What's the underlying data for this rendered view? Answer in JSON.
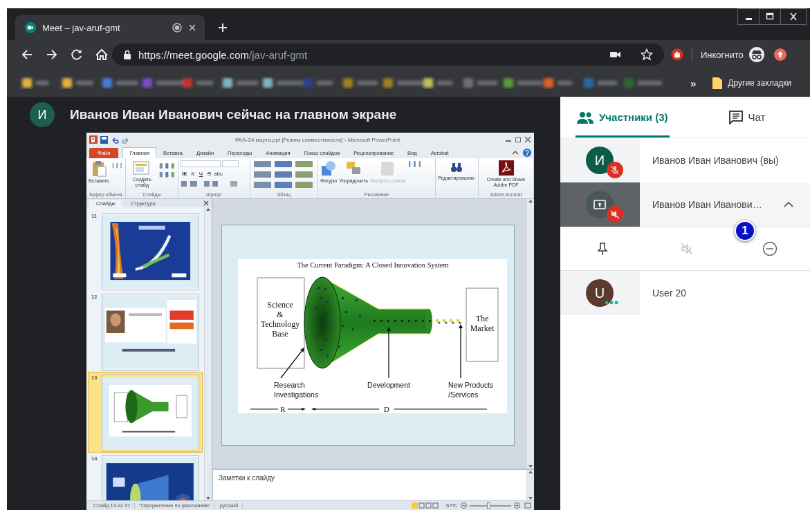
{
  "browser": {
    "tab": {
      "title": "Meet – jav-aruf-gmt"
    },
    "url": {
      "host": "https://meet.google.com",
      "path": "/jav-aruf-gmt"
    },
    "incognito_label": "Инкогнито",
    "bookmarks": {
      "overflow": "»",
      "other": "Другие закладки"
    }
  },
  "stage": {
    "presenter": {
      "initial": "И",
      "text": "Иванов Иван Иванович сейчас на главном экране"
    }
  },
  "powerpoint": {
    "title": "ФКА-24 марта.ppt [Режим совместимости] - Microsoft PowerPoint",
    "ribbon_tabs": [
      {
        "label": "Файл",
        "kind": "file",
        "selected": false
      },
      {
        "label": "Главная",
        "kind": "tab",
        "selected": true
      },
      {
        "label": "Вставка",
        "kind": "tab",
        "selected": false
      },
      {
        "label": "Дизайн",
        "kind": "tab",
        "selected": false
      },
      {
        "label": "Переходы",
        "kind": "tab",
        "selected": false
      },
      {
        "label": "Анимация",
        "kind": "tab",
        "selected": false
      },
      {
        "label": "Показ слайдов",
        "kind": "tab",
        "selected": false
      },
      {
        "label": "Рецензирование",
        "kind": "tab",
        "selected": false
      },
      {
        "label": "Вид",
        "kind": "tab",
        "selected": false
      },
      {
        "label": "Acrobat",
        "kind": "tab",
        "selected": false
      }
    ],
    "ribbon_groups": [
      {
        "label": "Буфер обмена",
        "kind": "clipboard",
        "buttons": [
          "Вставить"
        ]
      },
      {
        "label": "Слайды",
        "kind": "slides",
        "buttons": [
          "Создать слайд"
        ]
      },
      {
        "label": "Шрифт",
        "kind": "font",
        "buttons": [
          "Ж",
          "К",
          "Ч",
          "S",
          "abc"
        ]
      },
      {
        "label": "Абзац",
        "kind": "paragraph"
      },
      {
        "label": "Рисование",
        "kind": "drawing",
        "buttons": [
          "Фигуры",
          "Упорядочить",
          "Экспресс-стили"
        ]
      },
      {
        "kind": "editing",
        "buttons": [
          "Редактирование"
        ]
      },
      {
        "label": "Adobe Acrobat",
        "kind": "acrobat",
        "buttons": [
          "Create and Share Adobe PDF"
        ]
      }
    ],
    "pane_tabs": [
      {
        "label": "Слайды",
        "selected": true
      },
      {
        "label": "Структура",
        "selected": false
      }
    ],
    "thumbnails": [
      {
        "number": "11",
        "selected": false
      },
      {
        "number": "12",
        "selected": false
      },
      {
        "number": "13",
        "selected": true
      },
      {
        "number": "14",
        "selected": false
      }
    ],
    "slide": {
      "title": "The Current Paradigm: A Closed Innovation System",
      "source_lines": [
        "Science",
        "&",
        "Technology",
        "Base"
      ],
      "market_lines": [
        "The",
        "Market"
      ],
      "labels": [
        {
          "lines": [
            "Research",
            "Investigations"
          ]
        },
        {
          "lines": [
            "Development"
          ]
        },
        {
          "lines": [
            "New Products",
            "/Services"
          ]
        }
      ],
      "axis": [
        "R",
        "D"
      ]
    },
    "notes_placeholder": "Заметки к слайду",
    "status_bar": [
      "Слайд 13 из 37",
      "\"Оформление по умолчанию\"",
      "русский"
    ],
    "zoom": "67%",
    "zoom_slider": {
      "level": 0.45
    }
  },
  "participants_panel": {
    "tabs": [
      {
        "label": "Участники (3)",
        "kind": "people",
        "selected": true
      },
      {
        "label": "Чат",
        "kind": "chat",
        "selected": false
      }
    ],
    "participants": [
      {
        "kind": "person",
        "initial": "И",
        "color": "#0d5c48",
        "name": "Иванов Иван Иванович (вы)",
        "mic_muted": true,
        "audio_muted": false,
        "speaking": false,
        "expanded": false
      },
      {
        "kind": "presentation",
        "color": "#4a5757",
        "name": "Иванов Иван Иванови…",
        "mic_muted": false,
        "audio_muted": true,
        "speaking": false,
        "expanded": true
      },
      {
        "kind": "person",
        "initial": "U",
        "color": "#5d3a2e",
        "name": "User 20",
        "mic_muted": false,
        "audio_muted": false,
        "speaking": true,
        "expanded": false
      }
    ],
    "badge": "1"
  }
}
